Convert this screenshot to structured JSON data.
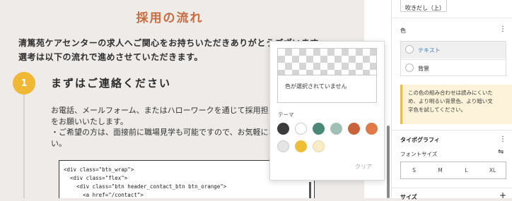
{
  "page": {
    "title": "採用の流れ",
    "intro": "清篤苑ケアセンターの求人へご関心をお持ちいただきありがとうございます。\n選考は以下の流れで進めさせていただきます。",
    "step": {
      "number": "1",
      "title": "まずはご連絡ください",
      "body": "お電話、メールフォーム、またはハローワークを通じて採用担当の\nをお願いいたします。\n・ご希望の方は、面接前に職場見学も可能ですので、お気軽にお申\nい。"
    },
    "code": "<div class=\"btn_wrap\">\n  <div class=\"flex\">\n    <div class=\"btn header_contact_btn btn_orange\">\n      <a href=\"/contact\">"
  },
  "popover": {
    "no_color_label": "色が選択されていません",
    "theme_label": "テーマ",
    "clear_label": "クリア",
    "swatches": [
      {
        "name": "dark-gray",
        "color": "#3c3c3c"
      },
      {
        "name": "white",
        "color": "#ffffff"
      },
      {
        "name": "green",
        "color": "#4a8878"
      },
      {
        "name": "sage",
        "color": "#a2bfb6"
      },
      {
        "name": "rust",
        "color": "#c8643c"
      },
      {
        "name": "orange",
        "color": "#e07a48"
      },
      {
        "name": "light-gray",
        "color": "#e5e5e5"
      },
      {
        "name": "yellow",
        "color": "#f0be34"
      },
      {
        "name": "cream",
        "color": "#f8edc6"
      }
    ]
  },
  "sidebar": {
    "balloon_label": "吹きだし（上）",
    "color_title": "色",
    "color_items": [
      {
        "label": "テキスト",
        "color": "#3a82c4"
      },
      {
        "label": "背景",
        "color": "#1e1e1e"
      }
    ],
    "notice": "この色の組み合わせは読みにくいた\nめ、より明るい背景色、より暗い文\n字色を試してください。",
    "typography_title": "タイポグラフィ",
    "font_size_label": "フォントサイズ",
    "sizes": [
      "S",
      "M",
      "L",
      "XL"
    ],
    "size_section_title": "サイズ"
  }
}
